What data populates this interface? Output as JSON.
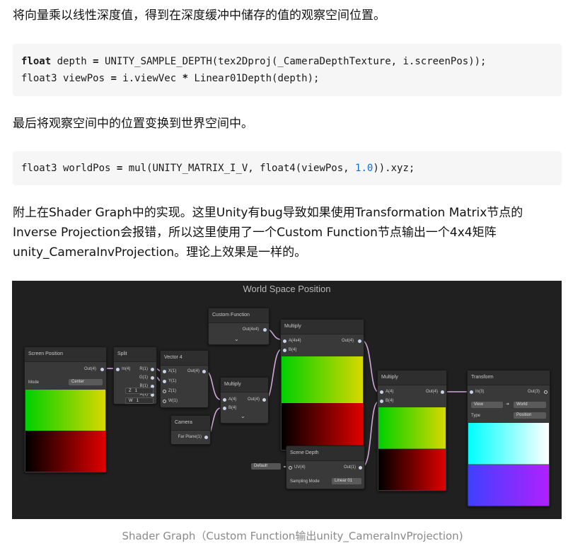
{
  "text": {
    "p1": "将向量乘以线性深度值，得到在深度缓冲中储存的值的观察空间位置。",
    "p2": "最后将观察空间中的位置变换到世界空间中。",
    "p3_line1": "附上在Shader Graph中的实现。这里Unity有bug导致如果使用Transformation Matrix节点的",
    "p3_line2": "Inverse Projection会报错，所以这里使用了一个Custom Function节点输出一个4x4矩阵",
    "p3_line3": "unity_CameraInvProjection。理论上效果是一样的。",
    "caption": "Shader Graph（Custom Function输出unity_CameraInvProjection)"
  },
  "code1": {
    "l1_kw": "float",
    "l1_a": " depth ",
    "l1_op": "=",
    "l1_b": " UNITY_SAMPLE_DEPTH(tex2Dproj(_CameraDepthTexture, i.screenPos));",
    "l2_a": "float3 viewPos ",
    "l2_op": "=",
    "l2_b": " i.viewVec ",
    "l2_op2": "*",
    "l2_c": " Linear01Depth(depth);"
  },
  "code2": {
    "a": "float3 worldPos ",
    "op": "=",
    "b": " mul(UNITY_MATRIX_I_V, float4(viewPos, ",
    "num": "1.0",
    "c": ")).xyz;"
  },
  "graph": {
    "title": "World Space Position",
    "screen_position": {
      "title": "Screen Position",
      "out": "Out(4)",
      "mode_label": "Mode",
      "mode_value": "Center"
    },
    "split": {
      "title": "Split",
      "in": "In(4)",
      "r": "R(1)",
      "g": "G(1)",
      "b": "B(1)",
      "a": "A(1)"
    },
    "vector4": {
      "title": "Vector 4",
      "x": "X(1)",
      "y": "Y(1)",
      "z": "Z(1)",
      "w": "W(1)",
      "out": "Out(4)",
      "z_label": "Z",
      "z_val": "1",
      "w_label": "W",
      "w_val": "1"
    },
    "custom_function": {
      "title": "Custom Function",
      "out": "Out(4x4)"
    },
    "multiply1": {
      "title": "Multiply",
      "a": "A(4x4)",
      "b": "B(4)",
      "out": "Out(4)"
    },
    "multiply2": {
      "title": "Multiply",
      "a": "A(4)",
      "b": "B(4)",
      "out": "Out(4)"
    },
    "camera": {
      "title": "Camera",
      "far": "Far Plane(1)"
    },
    "multiply3": {
      "title": "Multiply",
      "a": "A(4)",
      "b": "B(4)",
      "out": "Out(4)"
    },
    "scene_depth": {
      "title": "Scene Depth",
      "uv": "UV(4)",
      "out": "Out(1)",
      "mode_label": "Sampling Mode",
      "mode_value": "Linear 01",
      "default": "Default"
    },
    "transform": {
      "title": "Transform",
      "in": "In(3)",
      "out": "Out(3)",
      "from": "View",
      "to": "World",
      "type_label": "Type",
      "type_value": "Position"
    }
  },
  "colors": {
    "code_bg": "#f6f6f6",
    "number": "#0b6fd6",
    "graph_bg": "#202020",
    "node": "#393939"
  }
}
